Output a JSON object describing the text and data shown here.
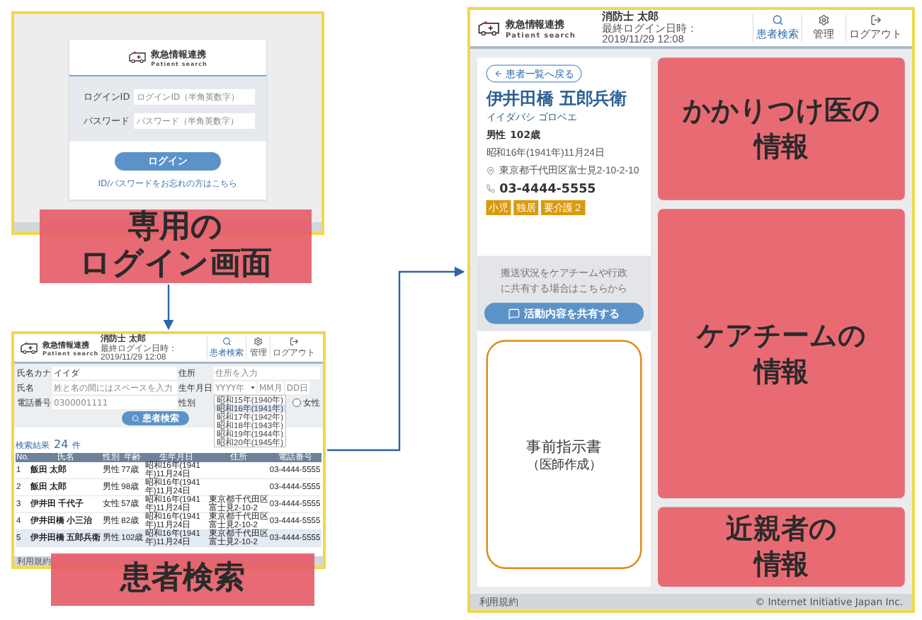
{
  "login_screen": {
    "logo": {
      "title": "救急情報連携",
      "subtitle": "Patient search"
    },
    "fields": [
      {
        "label": "ログインID",
        "placeholder": "ログインID（半角英数字）"
      },
      {
        "label": "パスワード",
        "placeholder": "パスワード（半角英数字）"
      }
    ],
    "button": "ログイン",
    "forgot_link": "ID/パスワードをお忘れの方はこちら"
  },
  "login_caption": [
    "専用の",
    "ログイン画面"
  ],
  "search_screen": {
    "logo": {
      "title": "救急情報連携",
      "subtitle": "Patient search"
    },
    "user": {
      "name": "消防士 太郎",
      "last_login": "最終ログイン日時：2019/11/29 12:08"
    },
    "nav": [
      {
        "label": "患者検索",
        "selected": true,
        "kind": "search"
      },
      {
        "label": "管理",
        "selected": false,
        "kind": "settings"
      },
      {
        "label": "ログアウト",
        "selected": false,
        "kind": "logout"
      }
    ],
    "form": {
      "kana": {
        "label": "氏名カナ",
        "value": "イイダ"
      },
      "address": {
        "label": "住所",
        "placeholder": "住所を入力"
      },
      "name": {
        "label": "氏名",
        "placeholder": "姓と名の間にはスペースを入力"
      },
      "birth": {
        "label": "生年月日",
        "year": "YYYY年",
        "month": "MM月",
        "day": "DD日"
      },
      "phone": {
        "label": "電話番号",
        "placeholder": "0300001111"
      },
      "gender": {
        "label": "性別",
        "options": [
          {
            "label": "女性",
            "selected": false
          }
        ]
      },
      "button": "患者検索"
    },
    "year_dropdown": [
      {
        "label": "昭和15年(1940年)",
        "selected": false
      },
      {
        "label": "昭和16年(1941年)",
        "selected": true
      },
      {
        "label": "昭和17年(1942年)",
        "selected": false
      },
      {
        "label": "昭和18年(1943年)",
        "selected": false
      },
      {
        "label": "昭和19年(1944年)",
        "selected": false
      },
      {
        "label": "昭和20年(1945年)",
        "selected": false
      }
    ],
    "results": {
      "label": "検索結果",
      "count": "24",
      "unit": "件",
      "columns": [
        "No.",
        "氏名",
        "性別",
        "年齢",
        "生年月日",
        "住所",
        "電話番号"
      ],
      "rows": [
        {
          "no": "1",
          "name": "飯田 太郎",
          "sex": "男性",
          "age": "77歳",
          "birth": "昭和16年(1941年)11月24日",
          "phone": "03-4444-5555",
          "selected": false
        },
        {
          "no": "2",
          "name": "飯田 太郎",
          "sex": "男性",
          "age": "98歳",
          "birth": "昭和16年(1941年)11月24日",
          "phone": "03-4444-5555",
          "selected": false
        },
        {
          "no": "3",
          "name": "伊井田 千代子",
          "sex": "女性",
          "age": "57歳",
          "birth": "昭和16年(1941年)11月24日",
          "address": "東京都千代田区富士見2-10-2",
          "phone": "03-4444-5555",
          "selected": false
        },
        {
          "no": "4",
          "name": "伊井田橋 小三治",
          "sex": "男性",
          "age": "82歳",
          "birth": "昭和16年(1941年)11月24日",
          "address": "東京都千代田区富士見2-10-2",
          "phone": "03-4444-5555",
          "selected": false
        },
        {
          "no": "5",
          "name": "伊井田橋 五郎兵衛",
          "sex": "男性",
          "age": "102歳",
          "birth": "昭和16年(1941年)11月24日",
          "address": "東京都千代田区富士見2-10-2",
          "phone": "03-4444-5555",
          "selected": true
        }
      ]
    },
    "footer": "利用規約"
  },
  "search_caption": "患者検索",
  "detail_screen": {
    "logo": {
      "title": "救急情報連携",
      "subtitle": "Patient search"
    },
    "user": {
      "name": "消防士 太郎",
      "last_login": "最終ログイン日時：2019/11/29 12:08"
    },
    "nav": [
      {
        "label": "患者検索",
        "selected": true,
        "kind": "search"
      },
      {
        "label": "管理",
        "selected": false,
        "kind": "settings"
      },
      {
        "label": "ログアウト",
        "selected": false,
        "kind": "logout"
      }
    ],
    "back_button": "患者一覧へ戻る",
    "patient": {
      "name": "伊井田橋 五郎兵衛",
      "kana": "イイダバシ ゴロベエ",
      "sex": "男性",
      "age": "102歳",
      "birth": "昭和16年(1941年)11月24日",
      "address": "東京都千代田区富士見2-10-2-10",
      "phone": "03-4444-5555",
      "tags": [
        "小児",
        "独居",
        "要介護２"
      ]
    },
    "share": {
      "note": "搬送状況をケアチームや行政に共有する場合はこちらから",
      "button": "活動内容を共有する"
    },
    "advance_directive": [
      "事前指示書",
      "（医師作成）"
    ],
    "overlays": [
      {
        "lines": [
          "かかりつけ医の",
          "情報"
        ]
      },
      {
        "lines": [
          "ケアチームの",
          "情報"
        ]
      },
      {
        "lines": [
          "近親者の",
          "情報"
        ]
      }
    ],
    "footer": "利用規約",
    "copyright": "© Internet Initiative Japan Inc."
  }
}
